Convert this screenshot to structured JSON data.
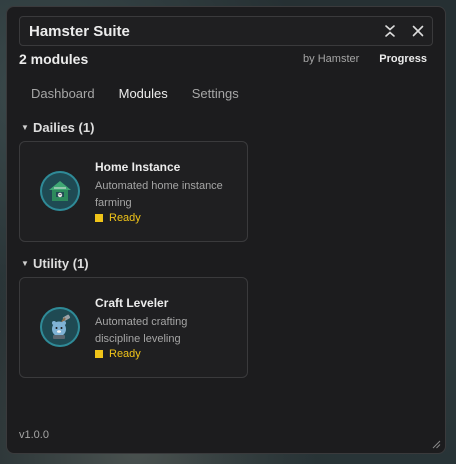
{
  "window": {
    "title": "Hamster Suite"
  },
  "header": {
    "count": "2 modules",
    "author": "by Hamster",
    "progress_label": "Progress"
  },
  "tabs": [
    {
      "label": "Dashboard",
      "active": false
    },
    {
      "label": "Modules",
      "active": true
    },
    {
      "label": "Settings",
      "active": false
    }
  ],
  "sections": [
    {
      "label": "Dailies (1)",
      "card": {
        "title": "Home Instance",
        "description": "Automated home instance farming",
        "status": "Ready",
        "icon": "house-icon"
      }
    },
    {
      "label": "Utility (1)",
      "card": {
        "title": "Craft Leveler",
        "description": "Automated crafting discipline leveling",
        "status": "Ready",
        "icon": "crafting-hamster-icon"
      }
    }
  ],
  "footer": {
    "version": "v1.0.0"
  },
  "colors": {
    "status_ready": "#f0c419",
    "icon_ring": "#2f8a97"
  }
}
